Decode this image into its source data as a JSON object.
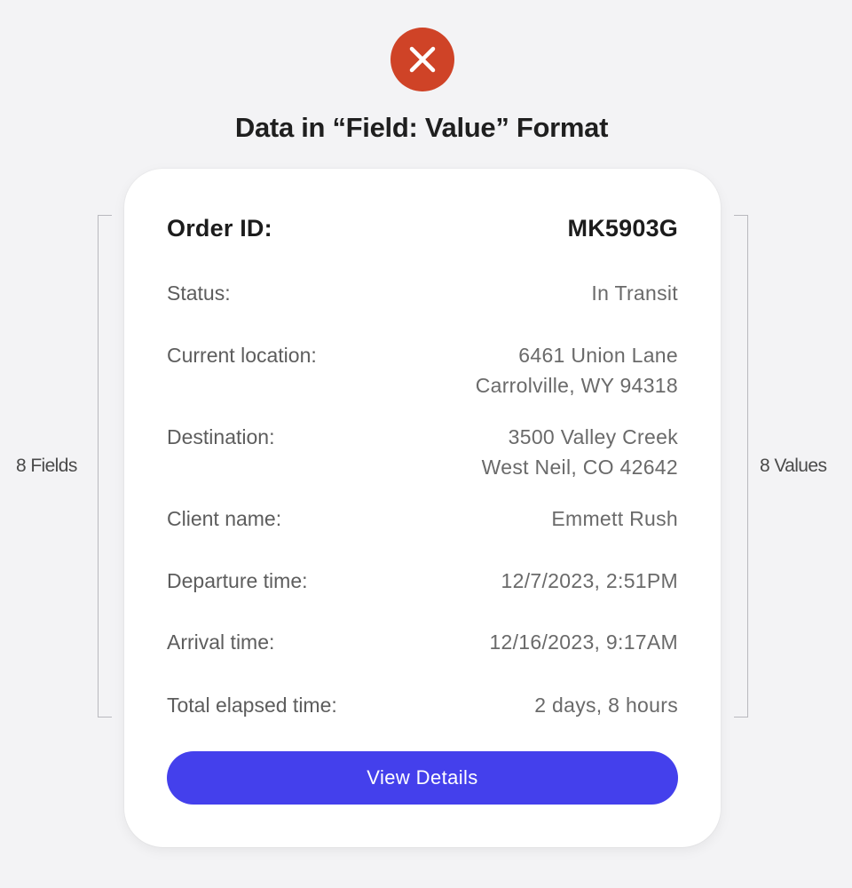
{
  "header": {
    "status_icon": "close-icon",
    "title": "Data in “Field: Value” Format"
  },
  "annotations": {
    "fields_label": "8 Fields",
    "values_label": "8 Values"
  },
  "card": {
    "order": {
      "field": "Order ID:",
      "value": "MK5903G"
    },
    "rows": [
      {
        "field": "Status:",
        "value_lines": [
          "In Transit"
        ]
      },
      {
        "field": "Current location:",
        "value_lines": [
          "6461 Union Lane",
          "Carrolville, WY 94318"
        ]
      },
      {
        "field": "Destination:",
        "value_lines": [
          "3500 Valley Creek",
          "West Neil, CO 42642"
        ]
      },
      {
        "field": "Client name:",
        "value_lines": [
          "Emmett Rush"
        ]
      },
      {
        "field": "Departure time:",
        "value_lines": [
          "12/7/2023, 2:51PM"
        ]
      },
      {
        "field": "Arrival time:",
        "value_lines": [
          "12/16/2023, 9:17AM"
        ]
      },
      {
        "field": "Total elapsed time:",
        "value_lines": [
          "2 days, 8 hours"
        ]
      }
    ],
    "button_label": "View Details"
  },
  "colors": {
    "error_badge": "#cf4327",
    "button": "#4440ec",
    "background": "#f3f3f5"
  }
}
